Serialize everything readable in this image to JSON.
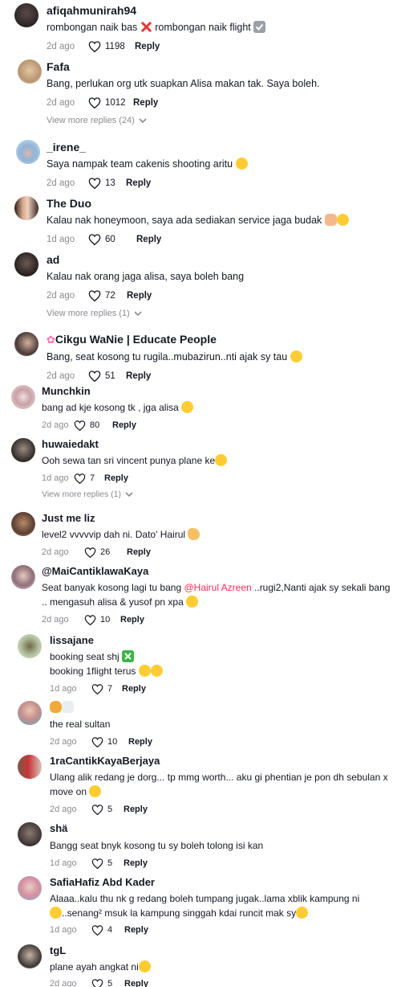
{
  "comments": [
    {
      "username": "afiqahmunirah94",
      "text_a": "rombongan naik bas",
      "text_b": " rombongan naik flight",
      "date": "2d ago",
      "likes": "1198",
      "reply": "Reply"
    },
    {
      "username": "Fafa",
      "text": "Bang, perlukan org utk suapkan Alisa makan tak. Saya boleh.",
      "date": "2d ago",
      "likes": "1012",
      "reply": "Reply",
      "more": "View more replies (24)"
    },
    {
      "username": "_irene_",
      "text": "Saya nampak team cakenis shooting aritu",
      "date": "2d ago",
      "likes": "13",
      "reply": "Reply"
    },
    {
      "username": "The Duo",
      "text": "Kalau nak honeymoon, saya ada sediakan service jaga budak",
      "date": "1d ago",
      "likes": "60",
      "reply": "Reply"
    },
    {
      "username": "ad",
      "text": "Kalau nak orang jaga alisa, saya boleh bang",
      "date": "2d ago",
      "likes": "72",
      "reply": "Reply",
      "more": "View more replies (1)"
    },
    {
      "username": "Cikgu WaNie | Educate People",
      "text": "Bang, seat kosong tu rugila..mubazirun..nti ajak sy tau",
      "date": "2d ago",
      "likes": "51",
      "reply": "Reply"
    },
    {
      "username": "Munchkin",
      "text": "bang ad kje kosong tk , jga alisa",
      "date": "2d ago",
      "likes": "80",
      "reply": "Reply"
    },
    {
      "username": "huwaiedakt",
      "text": "Ooh sewa tan sri vincent punya plane ke",
      "date": "1d ago",
      "likes": "7",
      "reply": "Reply",
      "more": "View more replies (1)"
    },
    {
      "username": "Just me liz",
      "text": "level2 vvvvvip dah ni. Dato' Hairul",
      "date": "2d ago",
      "likes": "26",
      "reply": "Reply"
    },
    {
      "username": "@MaiCantiklawaKaya",
      "text_a": "Seat banyak kosong lagi tu bang ",
      "mention": "@Hairul Azreen",
      "text_b": " ..rugi2,Nanti ajak sy sekali bang .. mengasuh alisa & yusof pn xpa",
      "date": "2d ago",
      "likes": "10",
      "reply": "Reply"
    },
    {
      "username": "lissajane",
      "line1": "booking seat shj",
      "line2": "booking 1flight terus",
      "date": "1d ago",
      "likes": "7",
      "reply": "Reply"
    },
    {
      "username": "",
      "text": "the real sultan",
      "date": "2d ago",
      "likes": "10",
      "reply": "Reply"
    },
    {
      "username": "1raCantikKayaBerjaya",
      "text": "Ulang alik redang je dorg... tp mmg worth... aku gi phentian je pon dh sebulan x move on",
      "date": "2d ago",
      "likes": "5",
      "reply": "Reply"
    },
    {
      "username": "shä",
      "text": "Bangg seat bnyk kosong tu sy boleh tolong isi kan",
      "date": "1d ago",
      "likes": "5",
      "reply": "Reply"
    },
    {
      "username": "SafiaHafiz Abd Kader",
      "line1": "Alaaa..kalu thu nk g redang boleh tumpang jugak..lama xblik kampung ni",
      "line2": "..senang² msuk la kampung singgah kdai runcit mak sy",
      "date": "1d ago",
      "likes": "4",
      "reply": "Reply"
    },
    {
      "username": "tgL",
      "text": "plane ayah angkat ni",
      "date": "2d ago",
      "likes": "5",
      "reply": "Reply"
    }
  ]
}
